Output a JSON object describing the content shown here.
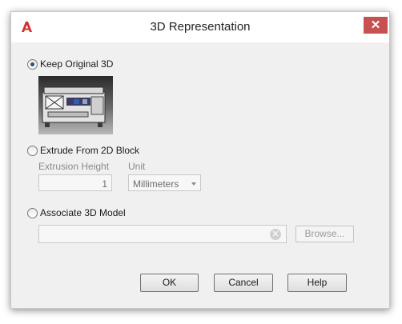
{
  "dialog": {
    "title": "3D Representation",
    "close_glyph": "✕",
    "logo_icon": "autocad-a-logo",
    "accent": "#c75050",
    "brand": "#d0312d"
  },
  "options": {
    "keep_original": {
      "label": "Keep Original 3D",
      "checked": true
    },
    "extrude": {
      "label": "Extrude From 2D Block",
      "checked": false
    },
    "associate": {
      "label": "Associate 3D Model",
      "checked": false
    }
  },
  "extrusion": {
    "height_label": "Extrusion Height",
    "height_value": "1",
    "unit_label": "Unit",
    "unit_value": "Millimeters"
  },
  "associate": {
    "path_value": "",
    "browse_label": "Browse..."
  },
  "buttons": {
    "ok": "OK",
    "cancel": "Cancel",
    "help": "Help"
  }
}
